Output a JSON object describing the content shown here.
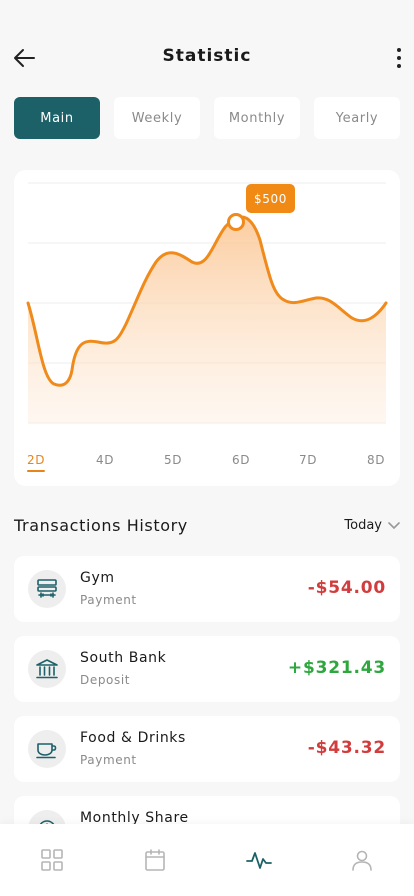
{
  "header": {
    "title": "Statistic"
  },
  "tabs": [
    {
      "label": "Main",
      "active": true
    },
    {
      "label": "Weekly",
      "active": false
    },
    {
      "label": "Monthly",
      "active": false
    },
    {
      "label": "Yearly",
      "active": false
    }
  ],
  "chart_data": {
    "type": "area",
    "x": [
      "2D",
      "4D",
      "5D",
      "6D",
      "7D",
      "8D"
    ],
    "selected_x": "2D",
    "tooltip": "$500",
    "grid": true,
    "colors": {
      "line": "#ef8a1b",
      "fill": "#fcd9b5"
    }
  },
  "transactions": {
    "title": "Transactions History",
    "filter": "Today",
    "items": [
      {
        "name": "Gym",
        "type": "Payment",
        "amount": "-$54.00",
        "sign": "neg",
        "icon": "gym-icon"
      },
      {
        "name": "South Bank",
        "type": "Deposit",
        "amount": "+$321.43",
        "sign": "pos",
        "icon": "bank-icon"
      },
      {
        "name": "Food & Drinks",
        "type": "Payment",
        "amount": "-$43.32",
        "sign": "neg",
        "icon": "cup-icon"
      },
      {
        "name": "Monthly Share",
        "type": "",
        "amount": "",
        "sign": "pos",
        "icon": "share-icon"
      }
    ]
  },
  "nav": [
    {
      "name": "grid-icon",
      "active": false
    },
    {
      "name": "calendar-icon",
      "active": false
    },
    {
      "name": "activity-icon",
      "active": true
    },
    {
      "name": "profile-icon",
      "active": false
    }
  ],
  "colors": {
    "accent": "#1c6168",
    "orange": "#f08a14",
    "negative": "#d23c3c",
    "positive": "#2ea83e"
  }
}
